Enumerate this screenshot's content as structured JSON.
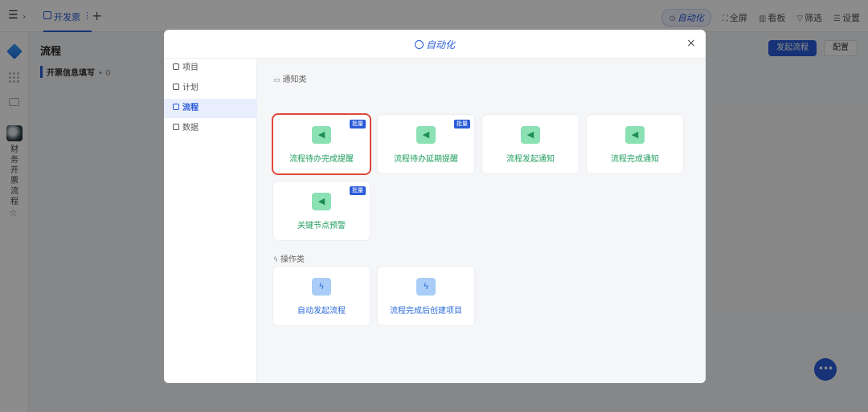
{
  "app": {
    "tab_label": "开发票",
    "top_actions": [
      {
        "label": "自动化",
        "icon": "automation-icon"
      },
      {
        "label": "全屏",
        "icon": "fullscreen-icon"
      },
      {
        "label": "看板",
        "icon": "kanban-icon"
      },
      {
        "label": "筛选",
        "icon": "filter-icon"
      },
      {
        "label": "设置",
        "icon": "settings-icon"
      }
    ],
    "sidebar_app_name": "财务开票流程",
    "page_title": "流程",
    "sub_title": "开票信息填写",
    "sub_count": "0",
    "start_button": "发起流程",
    "config_button": "配置",
    "fab_label": "•••"
  },
  "modal": {
    "title": "自动化",
    "close": "×",
    "nav": [
      {
        "label": "项目",
        "active": false
      },
      {
        "label": "计划",
        "active": false
      },
      {
        "label": "流程",
        "active": true
      },
      {
        "label": "数据",
        "active": false
      }
    ],
    "sections": {
      "notify": {
        "label": "通知类"
      },
      "operate": {
        "label": "操作类"
      }
    },
    "notify_cards": [
      {
        "label": "流程待办完成提醒",
        "badge": "批量",
        "selected": true
      },
      {
        "label": "流程待办延期提醒",
        "badge": "批量",
        "selected": false
      },
      {
        "label": "流程发起通知",
        "badge": "",
        "selected": false
      },
      {
        "label": "流程完成通知",
        "badge": "",
        "selected": false
      },
      {
        "label": "关键节点预警",
        "badge": "批量",
        "selected": false
      }
    ],
    "operate_cards": [
      {
        "label": "自动发起流程"
      },
      {
        "label": "流程完成后创建项目"
      }
    ]
  },
  "colors": {
    "accent": "#2a5cd8",
    "notify_green": "#1f9d5e",
    "selected_border": "#e0483a"
  }
}
